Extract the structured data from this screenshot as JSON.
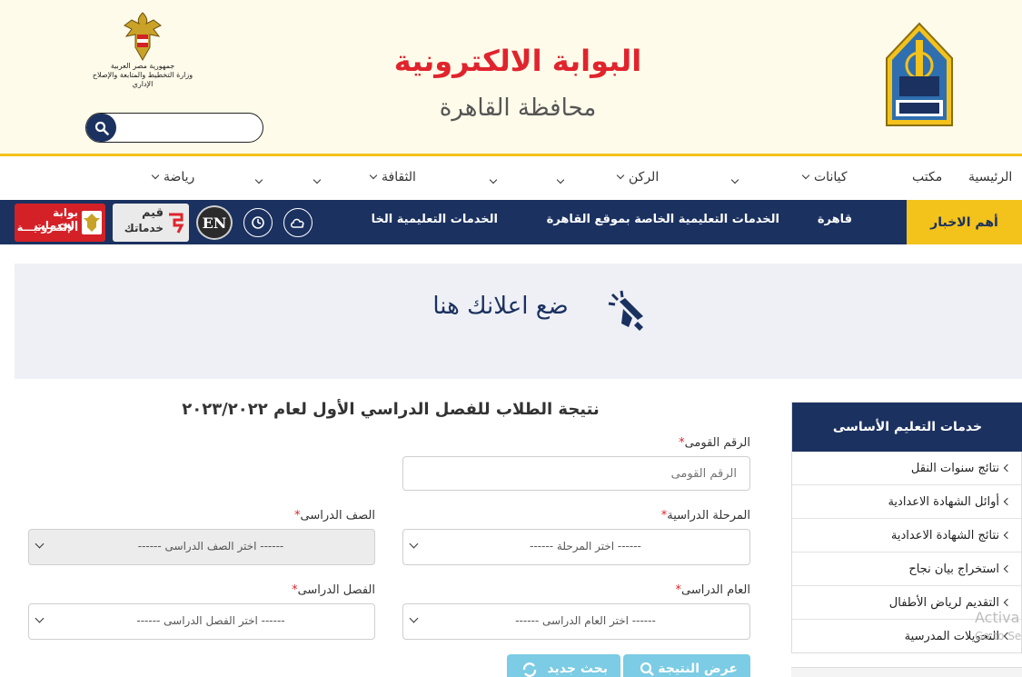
{
  "header": {
    "title": "البوابة الالكترونية",
    "subtitle": "محافظة القاهرة",
    "eagle_line1": "جمهورية مصر العربية",
    "eagle_line2": "وزارة التخطيط والمتابعة والإصلاح الإداري",
    "search_placeholder": ""
  },
  "nav": {
    "items": [
      "الرئيسية",
      "مكتب",
      "كيانات",
      "الركن",
      "الثقافة",
      "رياضة"
    ]
  },
  "newsbar": {
    "label": "أهم الاخبار",
    "ticker": [
      "قاهرة",
      "الخدمات التعليمية الخاصة بموقع القاهرة",
      "الخدمات التعليمية الخا"
    ],
    "en_label": "EN",
    "rate_line1": "قيم",
    "rate_line2": "خدماتك",
    "gov_line1": "بوابة الخدمات",
    "gov_line2": "الإلكترونيـــة"
  },
  "ad": {
    "text": "ضع اعلانك هنا"
  },
  "sidebar": {
    "title": "خدمات التعليم الأساسى",
    "items": [
      "نتائج سنوات النقل",
      "أوائل الشهادة الاعدادية",
      "نتائج الشهادة الاعدادية",
      "استخراج بيان نجاح",
      "التقديم لرياض الأطفال",
      "التحويلات المدرسية"
    ]
  },
  "watermark": {
    "line1": "Activa",
    "line2": "Go to Se"
  },
  "form": {
    "title": "نتيجة الطلاب للفصل الدراسي الأول لعام ٢٠٢٣/٢٠٢٢",
    "required_mark": "*",
    "national_id_label": "الرقم القومى",
    "national_id_placeholder": "الرقم القومى",
    "stage_label": "المرحلة الدراسية",
    "stage_value": "------ اختر المرحلة ------",
    "grade_label": "الصف الدراسى",
    "grade_value": "------ اختر الصف الدراسى ------",
    "year_label": "العام الدراسى",
    "year_value": "------ اختر العام الدراسى ------",
    "term_label": "الفصل الدراسى",
    "term_value": "------ اختر الفصل الدراسى ------",
    "show_button": "عرض النتيجة",
    "new_search_button": "بحث جديد"
  },
  "colors": {
    "navy": "#1b3160",
    "gold": "#f3c21b",
    "red": "#e0242d",
    "cyan": "#5bc0de"
  }
}
